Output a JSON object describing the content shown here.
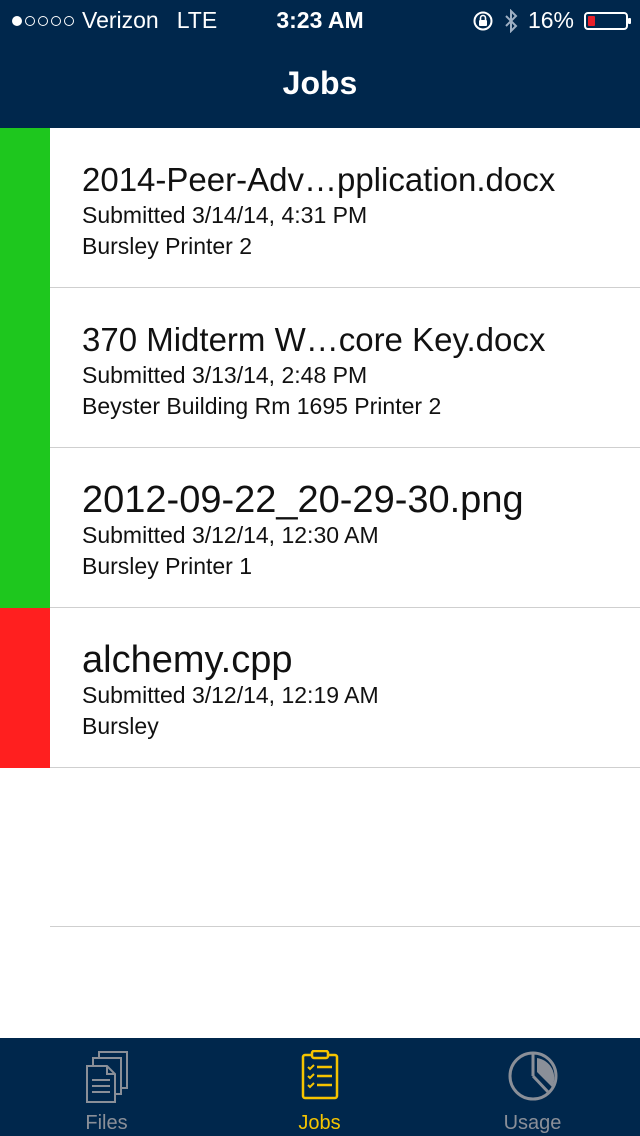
{
  "status_bar": {
    "carrier": "Verizon",
    "network": "LTE",
    "time": "3:23 AM",
    "battery": "16%",
    "battery_level": 0.16,
    "signal_bars_filled": 1,
    "signal_bars_total": 5
  },
  "header": {
    "title": "Jobs"
  },
  "colors": {
    "nav_bg": "#00274c",
    "success": "#1ec71e",
    "error": "#ff1f1f",
    "active_tab": "#f5c400"
  },
  "jobs": [
    {
      "name": "2014-Peer-Adv…pplication.docx",
      "submitted": "Submitted 3/14/14, 4:31 PM",
      "printer": "Bursley Printer 2",
      "status": "success"
    },
    {
      "name": "370 Midterm W…core Key.docx",
      "submitted": "Submitted 3/13/14, 2:48 PM",
      "printer": "Beyster Building Rm 1695 Printer 2",
      "status": "success"
    },
    {
      "name": "2012-09-22_20-29-30.png",
      "submitted": "Submitted 3/12/14, 12:30 AM",
      "printer": "Bursley Printer 1",
      "status": "success"
    },
    {
      "name": "alchemy.cpp",
      "submitted": "Submitted 3/12/14, 12:19 AM",
      "printer": "Bursley",
      "status": "error"
    }
  ],
  "tabs": [
    {
      "label": "Files",
      "icon": "files-icon",
      "active": false
    },
    {
      "label": "Jobs",
      "icon": "jobs-icon",
      "active": true
    },
    {
      "label": "Usage",
      "icon": "pie-chart-icon",
      "active": false
    }
  ]
}
